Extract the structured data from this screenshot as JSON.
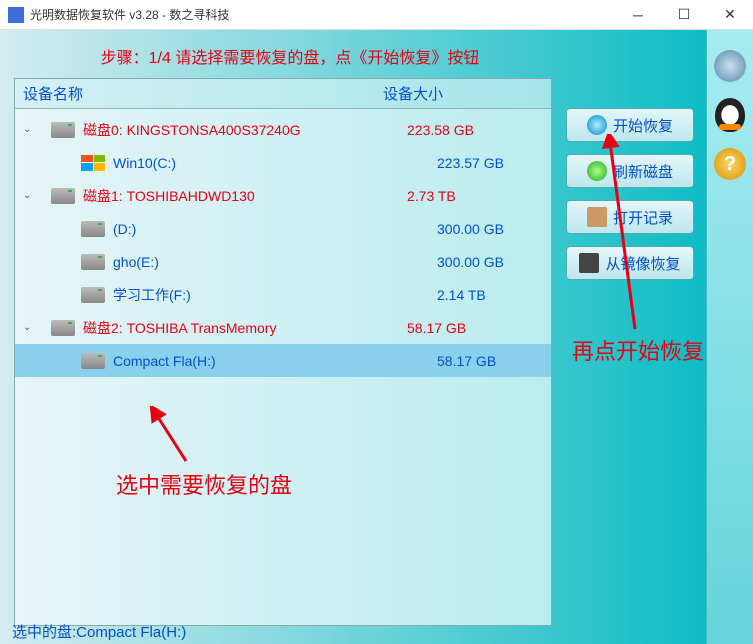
{
  "window": {
    "title": "光明数据恢复软件 v3.28 - 数之寻科技"
  },
  "step_text": "步骤：1/4 请选择需要恢复的盘，点《开始恢复》按钮",
  "columns": {
    "name": "设备名称",
    "size": "设备大小"
  },
  "disks": [
    {
      "label": "磁盘0: KINGSTONSA400S37240G",
      "size": "223.58 GB",
      "partitions": [
        {
          "label": "Win10(C:)",
          "size": "223.57 GB",
          "win": true
        }
      ]
    },
    {
      "label": "磁盘1: TOSHIBAHDWD130",
      "size": "2.73 TB",
      "partitions": [
        {
          "label": "(D:)",
          "size": "300.00 GB"
        },
        {
          "label": "gho(E:)",
          "size": "300.00 GB"
        },
        {
          "label": "学习工作(F:)",
          "size": "2.14 TB"
        }
      ]
    },
    {
      "label": "磁盘2: TOSHIBA  TransMemory",
      "size": "58.17 GB",
      "partitions": [
        {
          "label": "Compact Fla(H:)",
          "size": "58.17 GB",
          "selected": true
        }
      ]
    }
  ],
  "buttons": {
    "start": "开始恢复",
    "refresh": "刷新磁盘",
    "open_log": "打开记录",
    "from_mirror": "从镜像恢复"
  },
  "annotations": {
    "select_disk": "选中需要恢复的盘",
    "click_start": "再点开始恢复"
  },
  "status": "选中的盘:Compact Fla(H:)",
  "sidebar": {
    "gear": "settings",
    "qq": "qq-support",
    "help": "?"
  }
}
